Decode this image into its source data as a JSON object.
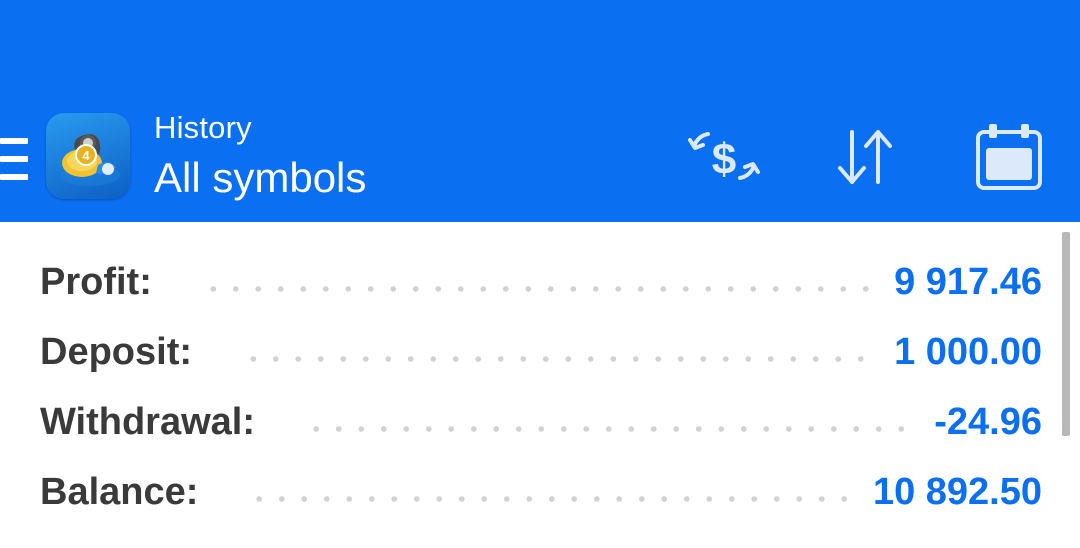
{
  "appbar": {
    "title": "History",
    "subtitle": "All symbols",
    "menu_icon": "hamburger-menu-icon",
    "logo_icon": "metatrader-app-logo",
    "actions": [
      {
        "icon": "currency-exchange-icon",
        "name": "operations-filter-button"
      },
      {
        "icon": "sort-arrows-icon",
        "name": "sort-button"
      },
      {
        "icon": "calendar-icon",
        "name": "period-button"
      }
    ],
    "background_color": "#0a6ff0"
  },
  "summary": {
    "profit": {
      "label": "Profit:",
      "value": "9 917.46"
    },
    "deposit": {
      "label": "Deposit:",
      "value": "1 000.00"
    },
    "withdrawal": {
      "label": "Withdrawal:",
      "value": "-24.96"
    },
    "balance": {
      "label": "Balance:",
      "value": "10 892.50"
    }
  },
  "colors": {
    "accent": "#0a6ff0",
    "label_text": "#3a3a3a",
    "dots": "#d2d2d2"
  }
}
